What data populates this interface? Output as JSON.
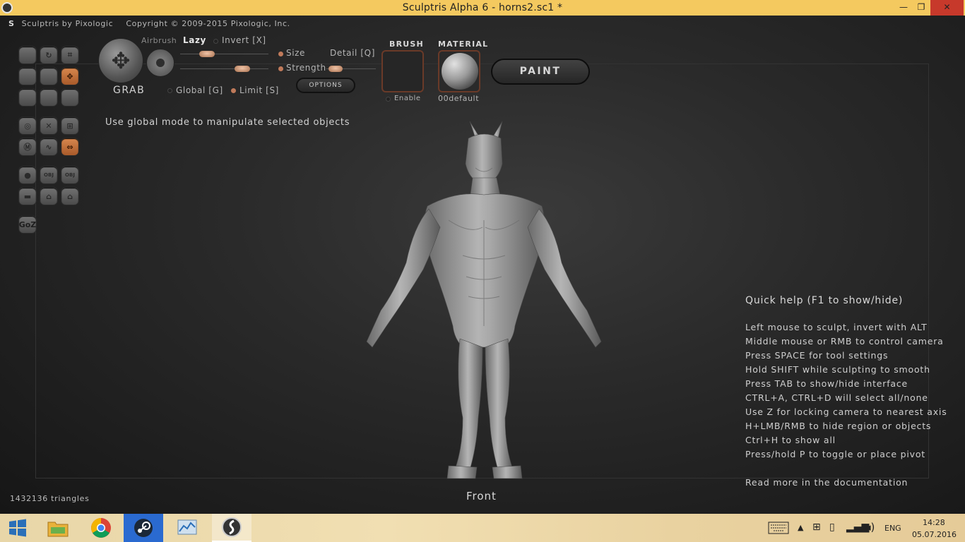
{
  "window": {
    "title": "Sculptris Alpha 6 - horns2.sc1 *",
    "min_glyph": "—",
    "max_glyph": "❐",
    "close_glyph": "✕"
  },
  "menu": {
    "app_name": "Sculptris by Pixologic",
    "copyright": "Copyright © 2009-2015 Pixologic, Inc."
  },
  "tools": {
    "goz_label": "GoZ",
    "obj_import_label": "OBJ",
    "obj_export_label": "OBJ"
  },
  "brush_panel": {
    "tool_name": "GRAB",
    "airbrush": "Airbrush",
    "lazy": "Lazy",
    "invert": "Invert [X]",
    "size": "Size",
    "detail": "Detail [Q]",
    "strength": "Strength",
    "global": "Global [G]",
    "limit": "Limit [S]",
    "options": "OPTIONS",
    "size_value": 0.3,
    "strength_value": 0.7,
    "detail_value": 0.2
  },
  "brush": {
    "label": "BRUSH",
    "enable": "Enable"
  },
  "material": {
    "label": "MATERIAL",
    "name": "00default"
  },
  "paint_button": "PAINT",
  "hint": "Use global mode to manipulate selected objects",
  "quick_help": {
    "title": "Quick help (F1 to show/hide)",
    "lines": [
      "Left mouse to sculpt, invert with ALT",
      "Middle mouse or RMB to control camera",
      "Press SPACE for tool settings",
      "Hold SHIFT while sculpting to smooth",
      "Press TAB to show/hide interface",
      "CTRL+A, CTRL+D will select all/none",
      "Use Z for locking camera to nearest axis",
      "H+LMB/RMB to hide region or objects",
      "Ctrl+H to show all",
      "Press/hold P to toggle or place pivot"
    ],
    "more": "Read more in the documentation"
  },
  "view_name": "Front",
  "triangles": "1432136 triangles",
  "taskbar": {
    "language": "ENG",
    "time": "14:28",
    "date": "05.07.2016"
  },
  "colors": {
    "accent": "#c0703c",
    "titlebar": "#f4c95f",
    "close": "#c7392b"
  }
}
